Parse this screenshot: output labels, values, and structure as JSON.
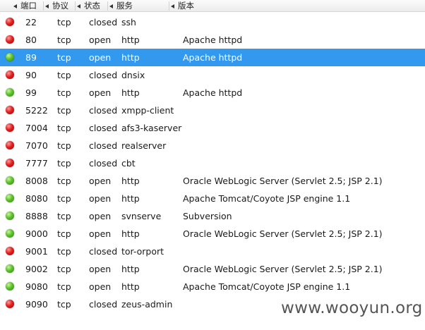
{
  "columns": {
    "port": "端口",
    "protocol": "协议",
    "state": "状态",
    "service": "服务",
    "version": "版本"
  },
  "status_colors": {
    "open": "#5cc02a",
    "closed": "#e12020",
    "selection": "#3399ee"
  },
  "selected_row": 2,
  "rows": [
    {
      "status": "closed",
      "port": "22",
      "protocol": "tcp",
      "state": "closed",
      "service": "ssh",
      "version": ""
    },
    {
      "status": "closed",
      "port": "80",
      "protocol": "tcp",
      "state": "open",
      "service": "http",
      "version": "Apache httpd"
    },
    {
      "status": "open",
      "port": "89",
      "protocol": "tcp",
      "state": "open",
      "service": "http",
      "version": "Apache httpd"
    },
    {
      "status": "closed",
      "port": "90",
      "protocol": "tcp",
      "state": "closed",
      "service": "dnsix",
      "version": ""
    },
    {
      "status": "open",
      "port": "99",
      "protocol": "tcp",
      "state": "open",
      "service": "http",
      "version": "Apache httpd"
    },
    {
      "status": "closed",
      "port": "5222",
      "protocol": "tcp",
      "state": "closed",
      "service": "xmpp-client",
      "version": ""
    },
    {
      "status": "closed",
      "port": "7004",
      "protocol": "tcp",
      "state": "closed",
      "service": "afs3-kaserver",
      "version": ""
    },
    {
      "status": "closed",
      "port": "7070",
      "protocol": "tcp",
      "state": "closed",
      "service": "realserver",
      "version": ""
    },
    {
      "status": "closed",
      "port": "7777",
      "protocol": "tcp",
      "state": "closed",
      "service": "cbt",
      "version": ""
    },
    {
      "status": "open",
      "port": "8008",
      "protocol": "tcp",
      "state": "open",
      "service": "http",
      "version": "Oracle WebLogic Server (Servlet 2.5; JSP 2.1)"
    },
    {
      "status": "open",
      "port": "8080",
      "protocol": "tcp",
      "state": "open",
      "service": "http",
      "version": "Apache Tomcat/Coyote JSP engine 1.1"
    },
    {
      "status": "open",
      "port": "8888",
      "protocol": "tcp",
      "state": "open",
      "service": "svnserve",
      "version": "Subversion"
    },
    {
      "status": "open",
      "port": "9000",
      "protocol": "tcp",
      "state": "open",
      "service": "http",
      "version": "Oracle WebLogic Server (Servlet 2.5; JSP 2.1)"
    },
    {
      "status": "closed",
      "port": "9001",
      "protocol": "tcp",
      "state": "closed",
      "service": "tor-orport",
      "version": ""
    },
    {
      "status": "open",
      "port": "9002",
      "protocol": "tcp",
      "state": "open",
      "service": "http",
      "version": "Oracle WebLogic Server (Servlet 2.5; JSP 2.1)"
    },
    {
      "status": "open",
      "port": "9080",
      "protocol": "tcp",
      "state": "open",
      "service": "http",
      "version": "Apache Tomcat/Coyote JSP engine 1.1"
    },
    {
      "status": "closed",
      "port": "9090",
      "protocol": "tcp",
      "state": "closed",
      "service": "zeus-admin",
      "version": ""
    }
  ],
  "watermark": "www.wooyun.org"
}
